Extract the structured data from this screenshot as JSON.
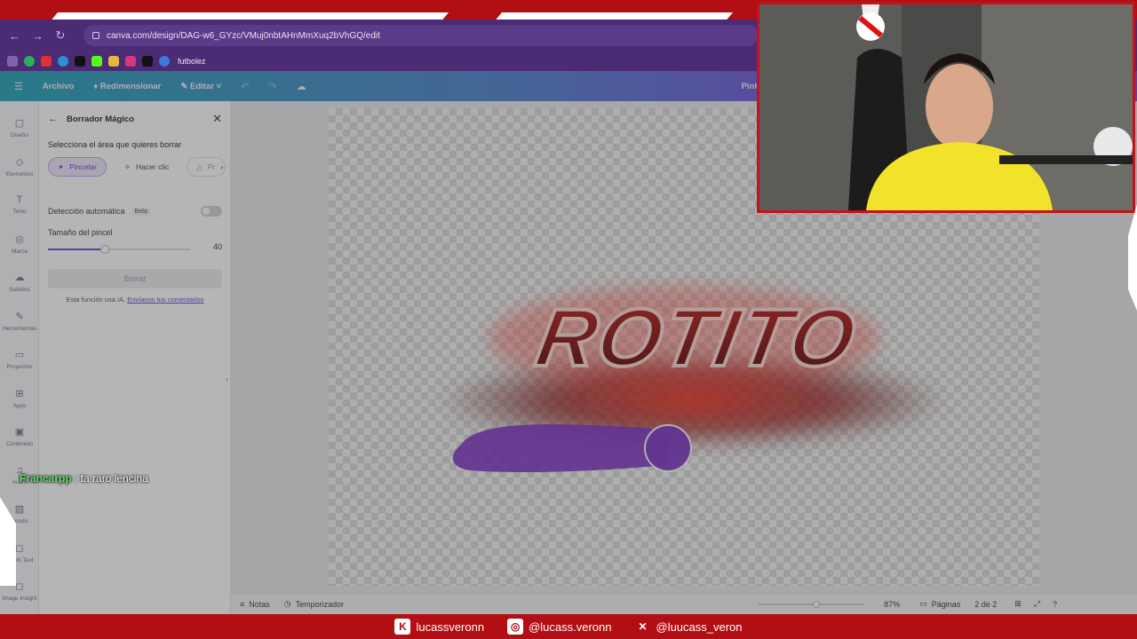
{
  "browser": {
    "url": "canva.com/design/DAG-w6_GYzc/VMuj0nbtAHnMmXuq2bVhGQ/edit",
    "bookmark_label": "futbolez"
  },
  "header": {
    "file": "Archivo",
    "resize": "Redimensionar",
    "edit": "Editar",
    "truncated_title": "Pink ..."
  },
  "rail": {
    "items": [
      {
        "label": "Diseño",
        "icon": "layout-icon"
      },
      {
        "label": "Elementos",
        "icon": "shapes-icon"
      },
      {
        "label": "Texto",
        "icon": "text-icon"
      },
      {
        "label": "Marca",
        "icon": "brand-icon"
      },
      {
        "label": "Subidos",
        "icon": "upload-icon"
      },
      {
        "label": "Herramientas",
        "icon": "draw-icon"
      },
      {
        "label": "Proyectos",
        "icon": "folder-icon"
      },
      {
        "label": "Apps",
        "icon": "apps-icon"
      },
      {
        "label": "Contenido",
        "icon": "image-icon"
      },
      {
        "label": "Audio",
        "icon": "music-icon"
      },
      {
        "label": "Fondo",
        "icon": "background-icon"
      },
      {
        "label": "Depth Text",
        "icon": "app-icon"
      },
      {
        "label": "Image Insight",
        "icon": "app-icon"
      }
    ]
  },
  "panel": {
    "title": "Borrador Mágico",
    "instruction": "Selecciona el área que quieres borrar",
    "modes": {
      "brush": "Pincelar",
      "click": "Hacer clic",
      "third": "Pr"
    },
    "auto_detect": "Detección automática",
    "beta": "Beta",
    "brush_size_label": "Tamaño del pincel",
    "brush_size_value": "40",
    "brush_size_fraction": 0.4,
    "erase_button": "Borrar",
    "ai_note": "Esta función usa IA.",
    "ai_link": "Envíanos tus comentarios"
  },
  "canvas": {
    "logo_text": "ROTITO",
    "zoom_slider_fraction": 0.55
  },
  "statusbar": {
    "notes": "Notas",
    "timer": "Temporizador",
    "zoom": "87%",
    "pages_label": "Páginas",
    "pages_value": "2 de 2"
  },
  "chat": {
    "user": "Francarpp",
    "message": ": ta raro lencina"
  },
  "social": {
    "kick": "lucassveronn",
    "instagram": "@lucass.veronn",
    "x": "@luucass_veron"
  },
  "colors": {
    "stream_red": "#b10f14",
    "canva_purple": "#7a3fe0",
    "brush_stroke": "#7b2fc4",
    "chat_user": "#61e36b"
  }
}
